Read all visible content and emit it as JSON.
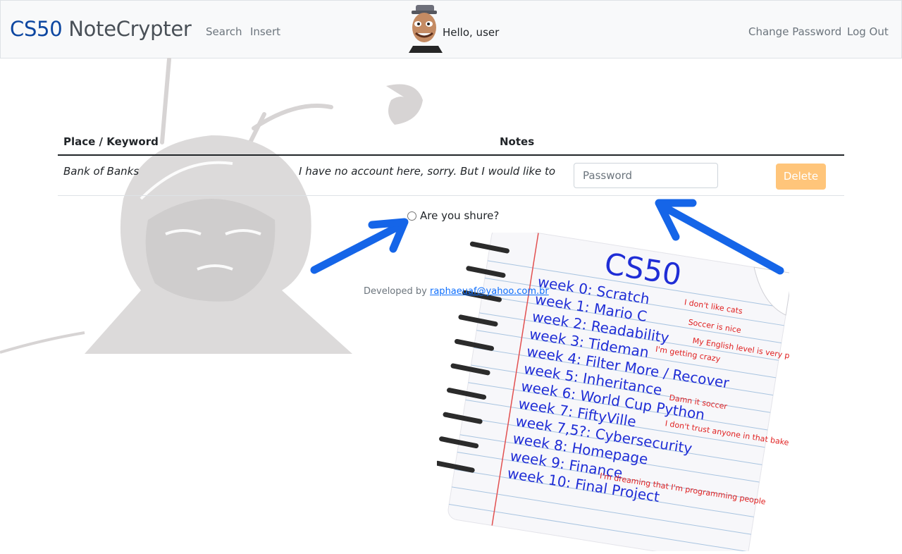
{
  "navbar": {
    "brand_prefix": "CS50",
    "brand_suffix": "NoteCrypter",
    "links": [
      "Search",
      "Insert"
    ],
    "greeting": "Hello, user",
    "right_links": [
      "Change Password",
      "Log Out"
    ]
  },
  "table": {
    "headers": [
      "Place / Keyword",
      "Notes"
    ],
    "rows": [
      {
        "place": "Bank of Banks",
        "note": "I have no account here, sorry. But I would like to",
        "password_placeholder": "Password",
        "delete_label": "Delete"
      }
    ]
  },
  "confirm": {
    "label": "Are you shure?"
  },
  "footer": {
    "prefix": "Developed by",
    "email": "raphaeuaf@yahoo.com.br"
  },
  "notebook": {
    "title": "CS50",
    "lines": [
      "week 0: Scratch",
      "week 1: Mario C",
      "week 2: Readability",
      "week 3: Tideman",
      "week 4: Filter More / Recover",
      "week 5: Inheritance",
      "week 6: World Cup Python",
      "week 7: FiftyVille",
      "week 7,5?: Cybersecurity",
      "week 8: Homepage",
      "week 9: Finance",
      "week 10: Final Project"
    ],
    "annotations": [
      "I don't like cats",
      "Soccer is nice",
      "My English level is very poor",
      "I'm getting crazy",
      "Damn it soccer",
      "I don't trust anyone in that bakery",
      "I'm dreaming that I'm programming people"
    ]
  },
  "colors": {
    "brand_blue": "#0d47a1",
    "link_grey": "#6c757d",
    "delete_button": "#ffc57a",
    "arrow_blue": "#1565e8",
    "footer_link": "#0d6efd"
  },
  "icons": [
    "avatar",
    "radio-button",
    "arrow-icon"
  ]
}
